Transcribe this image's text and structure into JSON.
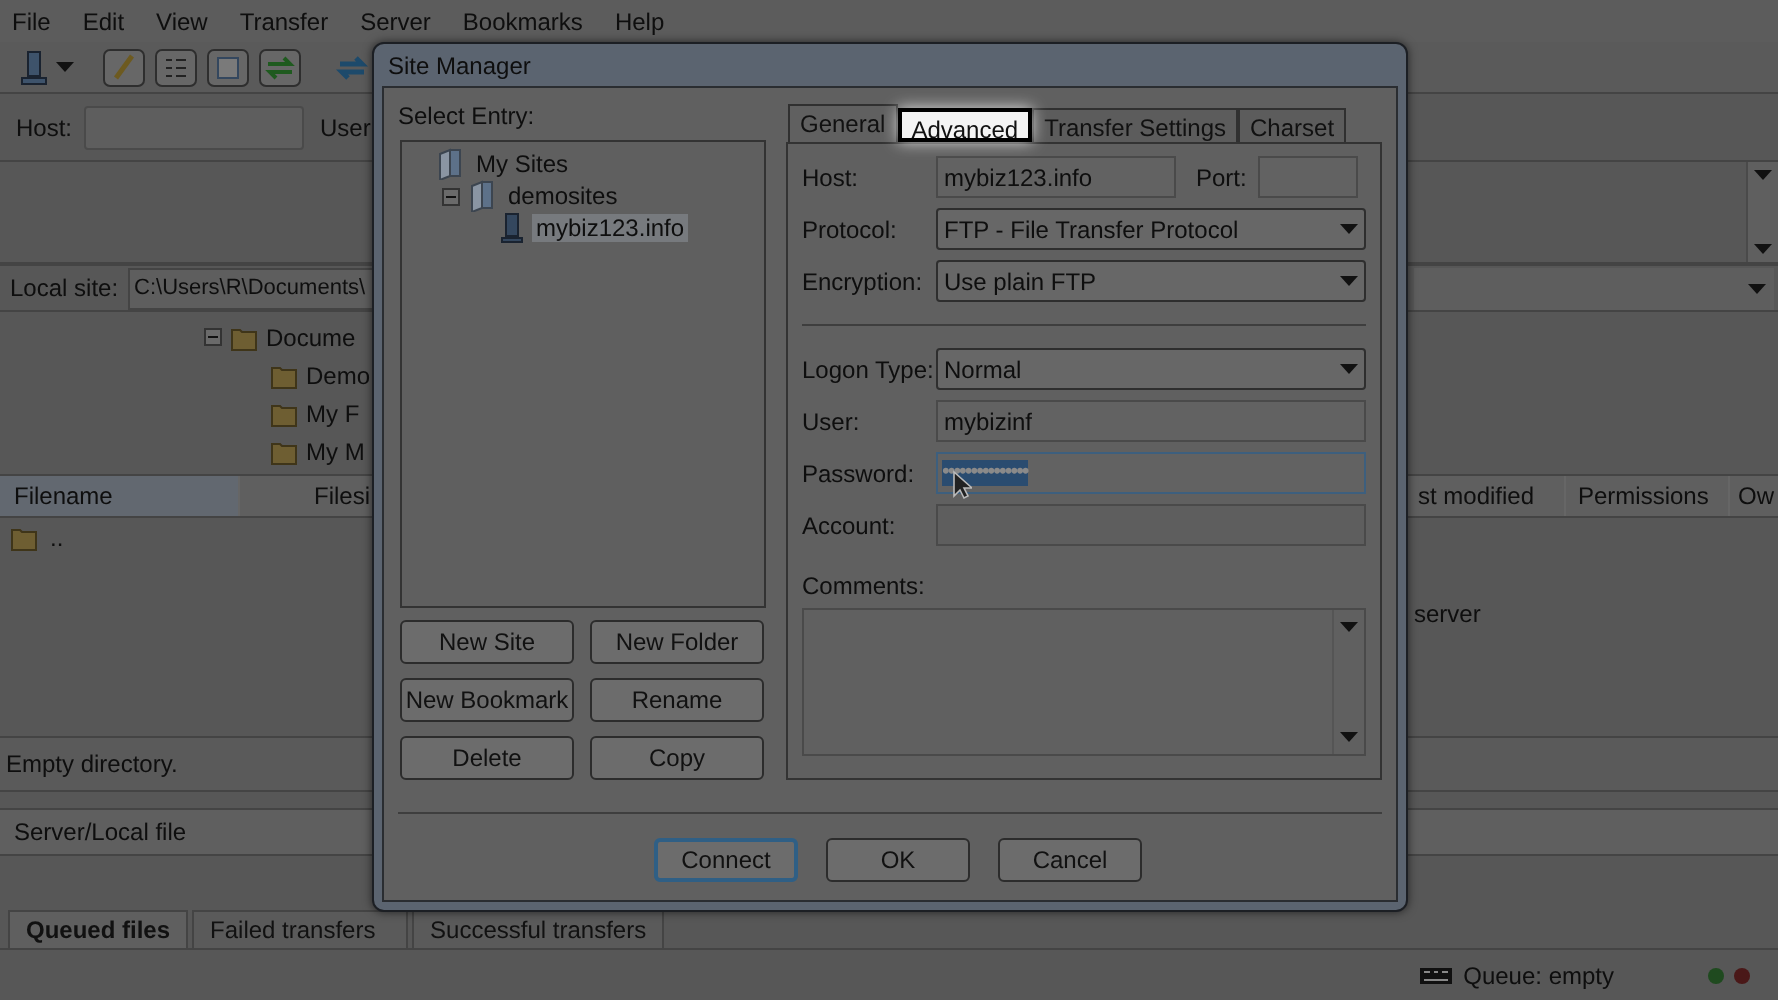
{
  "menu": [
    "File",
    "Edit",
    "View",
    "Transfer",
    "Server",
    "Bookmarks",
    "Help"
  ],
  "quickconnect": {
    "host_label": "Host:",
    "user_label": "User"
  },
  "local_site": {
    "label": "Local site:",
    "path": "C:\\Users\\R\\Documents\\"
  },
  "local_tree": [
    {
      "name": "Docume",
      "expanded": true,
      "children": [
        {
          "name": "Demo"
        },
        {
          "name": "My F"
        },
        {
          "name": "My M"
        }
      ]
    }
  ],
  "local_files": {
    "columns": [
      "Filename",
      "Filesi"
    ],
    "rows": [
      ".."
    ]
  },
  "remote_files": {
    "columns": [
      "st modified",
      "Permissions",
      "Ow"
    ],
    "message": "server"
  },
  "local_status": "Empty directory.",
  "queue": {
    "columns": [
      "Server/Local file"
    ]
  },
  "queue_tabs": [
    {
      "label": "Queued files",
      "selected": true
    },
    {
      "label": "Failed transfers",
      "selected": false
    },
    {
      "label": "Successful transfers",
      "selected": false
    }
  ],
  "status_bar": {
    "queue": "Queue: empty"
  },
  "site_manager": {
    "title": "Site Manager",
    "select_entry_label": "Select Entry:",
    "tree": [
      {
        "name": "My Sites",
        "kind": "folder",
        "selected": false,
        "children": [
          {
            "name": "demosites",
            "kind": "folder",
            "selected": false,
            "expanded": true,
            "children": [
              {
                "name": "mybiz123.info",
                "kind": "site",
                "selected": true
              }
            ]
          }
        ]
      }
    ],
    "entry_buttons": [
      "New Site",
      "New Folder",
      "New Bookmark",
      "Rename",
      "Delete",
      "Copy"
    ],
    "tabs": [
      {
        "label": "General",
        "selected": true,
        "highlighted": false
      },
      {
        "label": "Advanced",
        "selected": false,
        "highlighted": true
      },
      {
        "label": "Transfer Settings",
        "selected": false,
        "highlighted": false
      },
      {
        "label": "Charset",
        "selected": false,
        "highlighted": false
      }
    ],
    "host": {
      "label": "Host:",
      "value": "mybiz123.info"
    },
    "port": {
      "label": "Port:"
    },
    "protocol": {
      "label": "Protocol:",
      "value": "FTP - File Transfer Protocol"
    },
    "encryption": {
      "label": "Encryption:",
      "value": "Use plain FTP"
    },
    "logon_type": {
      "label": "Logon Type:",
      "value": "Normal"
    },
    "user": {
      "label": "User:",
      "value": "mybizinf"
    },
    "password": {
      "label": "Password:",
      "value": "•••••••••••••••",
      "text_selected": true
    },
    "account": {
      "label": "Account:"
    },
    "comments": {
      "label": "Comments:"
    },
    "buttons": [
      {
        "label": "Connect",
        "default": true
      },
      {
        "label": "OK",
        "default": false
      },
      {
        "label": "Cancel",
        "default": false
      }
    ]
  }
}
